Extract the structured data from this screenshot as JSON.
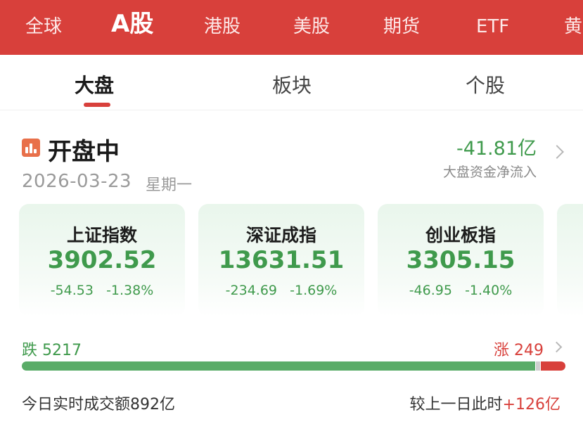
{
  "nav": {
    "items": [
      "全球",
      "A股",
      "港股",
      "美股",
      "期货",
      "ETF",
      "黄"
    ],
    "active": "A股"
  },
  "subtabs": {
    "items": [
      "大盘",
      "板块",
      "个股"
    ],
    "active": "大盘"
  },
  "status": {
    "icon": "candlestick-icon",
    "title": "开盘中",
    "date": "2026-03-23",
    "weekday": "星期一"
  },
  "capital_flow": {
    "value": "-41.81亿",
    "label": "大盘资金净流入"
  },
  "indices": [
    {
      "name": "上证指数",
      "price": "3902.52",
      "change": "-54.53",
      "percent": "-1.38%"
    },
    {
      "name": "深证成指",
      "price": "13631.51",
      "change": "-234.69",
      "percent": "-1.69%"
    },
    {
      "name": "创业板指",
      "price": "3305.15",
      "change": "-46.95",
      "percent": "-1.40%"
    }
  ],
  "breadth": {
    "fall_label": "跌",
    "fall_count": "5217",
    "rise_label": "涨",
    "rise_count": "249"
  },
  "turnover": {
    "label": "今日实时成交额",
    "value": "892亿"
  },
  "compare": {
    "label": "较上一日此时",
    "value": "+126亿"
  },
  "colors": {
    "brand_red": "#d8403b",
    "fall_green": "#3f9a4c",
    "card_bg": "#e9f6ec"
  }
}
